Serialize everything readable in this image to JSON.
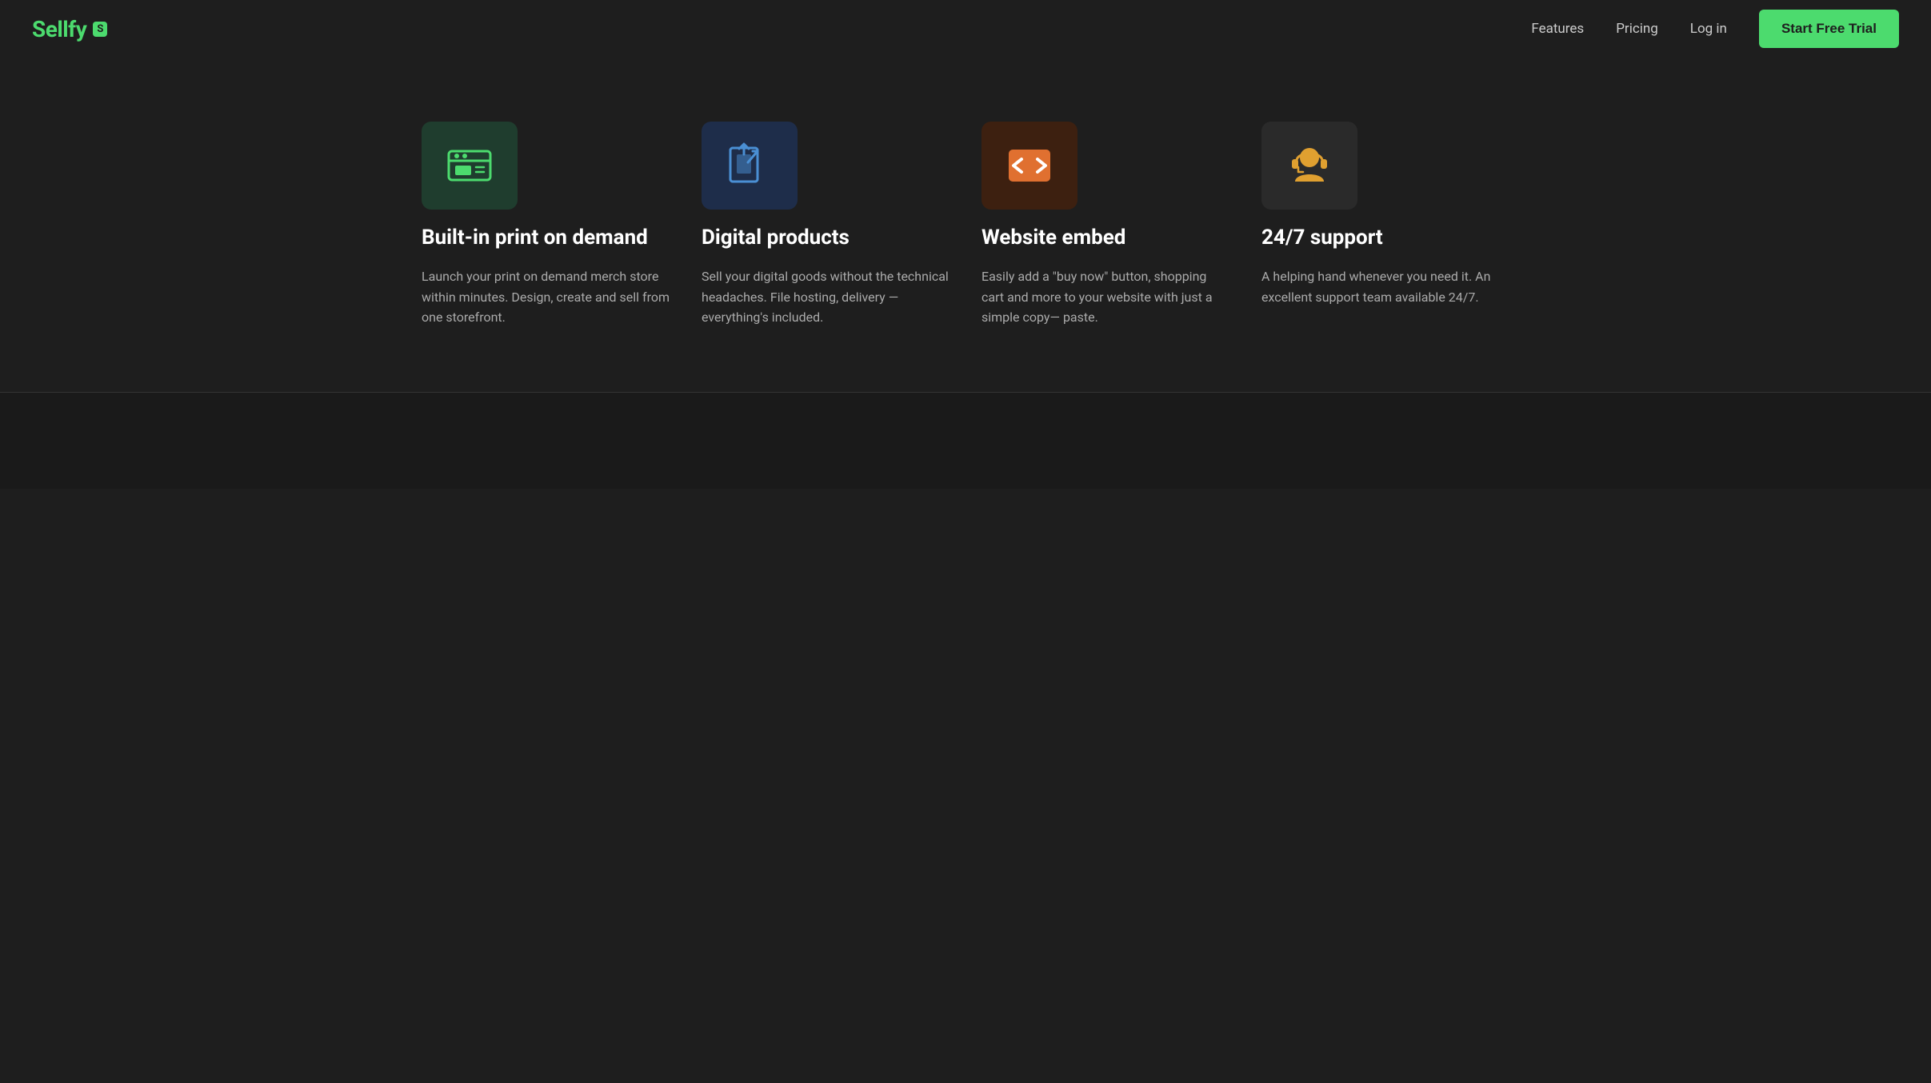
{
  "navbar": {
    "logo_text": "Sellfy",
    "logo_badge": "S",
    "nav_links": [
      {
        "label": "Features",
        "id": "features"
      },
      {
        "label": "Pricing",
        "id": "pricing"
      },
      {
        "label": "Log in",
        "id": "login"
      }
    ],
    "cta_label": "Start Free Trial"
  },
  "features": [
    {
      "id": "print-on-demand",
      "icon": "store-icon",
      "icon_theme": "green",
      "title": "Built-in print on demand",
      "description": "Launch your print on demand merch store within minutes. Design, create and sell from one storefront."
    },
    {
      "id": "digital-products",
      "icon": "upload-icon",
      "icon_theme": "blue",
      "title": "Digital products",
      "description": "Sell your digital goods without the technical headaches. File hosting, delivery — everything's included."
    },
    {
      "id": "website-embed",
      "icon": "code-icon",
      "icon_theme": "orange",
      "title": "Website embed",
      "description": "Easily add a \"buy now\" button, shopping cart and more to your website with just a simple copy— paste."
    },
    {
      "id": "support",
      "icon": "support-icon",
      "icon_theme": "dark",
      "title": "24/7 support",
      "description": "A helping hand whenever you need it. An excellent support team available 24/7."
    }
  ]
}
